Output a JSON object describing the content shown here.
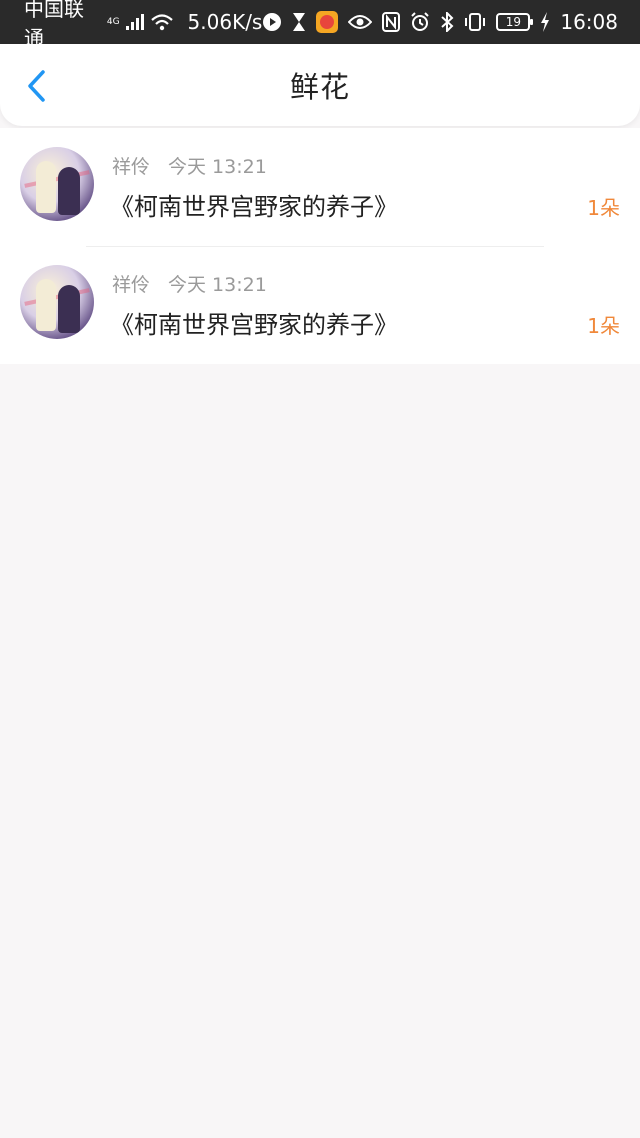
{
  "status_bar": {
    "carrier": "中国联通",
    "network": "4G",
    "speed": "5.06K/s",
    "battery": "19",
    "time": "16:08"
  },
  "header": {
    "title": "鲜花",
    "back_icon": "chevron-left-icon"
  },
  "colors": {
    "accent": "#2196f3",
    "count": "#f0883a",
    "meta": "#9a9a9a",
    "background": "#f8f6f7"
  },
  "items": [
    {
      "user": "祥伶",
      "time": "今天 13:21",
      "title": "《柯南世界宫野家的养子》",
      "count": "1朵"
    },
    {
      "user": "祥伶",
      "time": "今天 13:21",
      "title": "《柯南世界宫野家的养子》",
      "count": "1朵"
    }
  ]
}
